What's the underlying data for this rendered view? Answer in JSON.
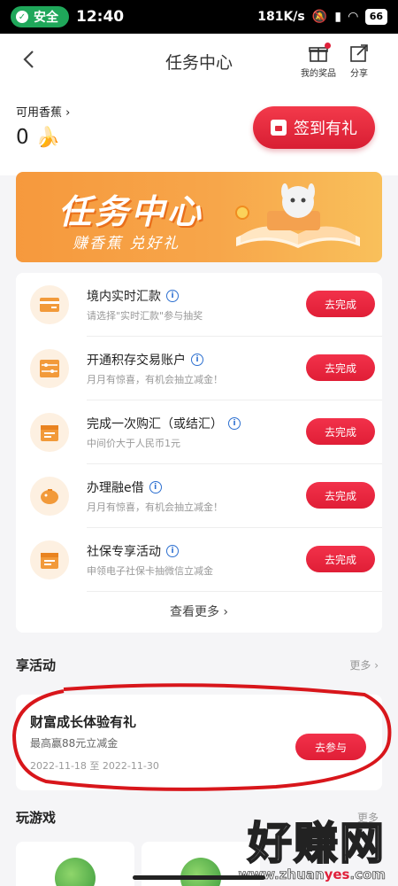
{
  "status_bar": {
    "safe_label": "安全",
    "time": "12:40",
    "speed": "181K/s",
    "battery": "66"
  },
  "header": {
    "title": "任务中心",
    "prize_label": "我的奖品",
    "share_label": "分享"
  },
  "banana": {
    "label": "可用香蕉",
    "count": "0",
    "signin_label": "签到有礼"
  },
  "banner": {
    "title": "任务中心",
    "subtitle": "赚香蕉 兑好礼"
  },
  "tasks": [
    {
      "title": "境内实时汇款",
      "desc": "请选择\"实时汇款\"参与抽奖",
      "button": "去完成",
      "icon": "card-transfer-icon"
    },
    {
      "title": "开通积存交易账户",
      "desc": "月月有惊喜，有机会抽立减金！",
      "button": "去完成",
      "icon": "abacus-icon"
    },
    {
      "title": "完成一次购汇（或结汇）",
      "desc": "中间价大于人民币1元",
      "button": "去完成",
      "icon": "calendar-icon"
    },
    {
      "title": "办理融e借",
      "desc": "月月有惊喜，有机会抽立减金！",
      "button": "去完成",
      "icon": "piggy-bank-icon"
    },
    {
      "title": "社保专享活动",
      "desc": "申领电子社保卡抽微信立减金",
      "button": "去完成",
      "icon": "calendar-icon"
    }
  ],
  "more_tasks_label": "查看更多",
  "activities": {
    "section_title": "享活动",
    "more_label": "更多",
    "item": {
      "title": "财富成长体验有礼",
      "desc": "最高赢88元立减金",
      "date": "2022-11-18 至 2022-11-30",
      "button": "去参与"
    }
  },
  "games": {
    "section_title": "玩游戏",
    "more_label": "更多"
  },
  "watermark": {
    "big": "好赚网",
    "small_a": "www.zhuan",
    "small_b": "yes",
    "small_c": ".com"
  },
  "colors": {
    "accent_red": "#e01e36",
    "banner_orange": "#f6993d",
    "info_blue": "#2c6fd0",
    "safe_green": "#1fa75a"
  }
}
